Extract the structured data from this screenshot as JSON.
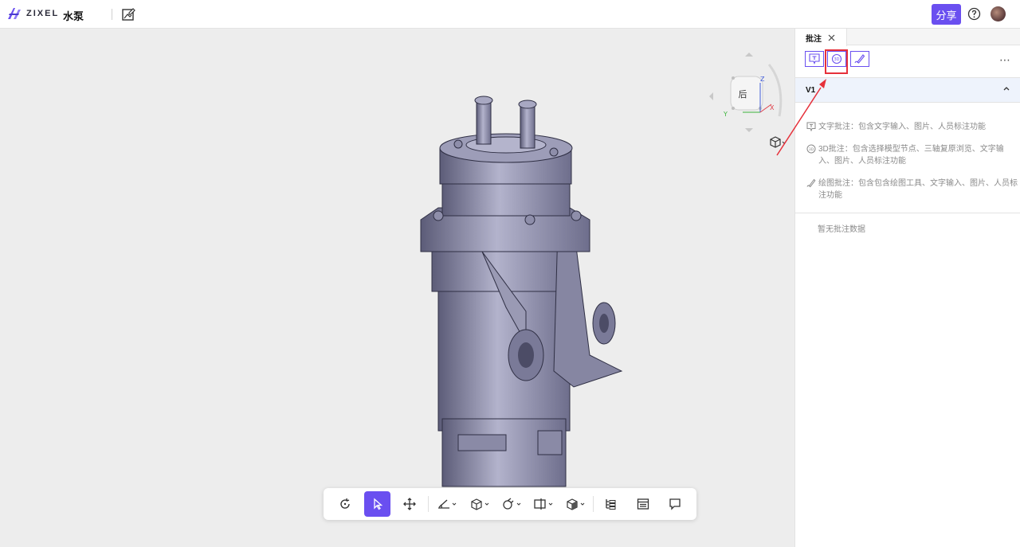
{
  "header": {
    "logo_text": "ZIXEL",
    "doc_title": "水泵",
    "share_label": "分享"
  },
  "viewport": {
    "nav_cube_face": "后",
    "axis_labels": [
      "Z",
      "Y",
      "X"
    ]
  },
  "toolbar": {
    "tools": [
      "rotate",
      "select",
      "pan",
      "measure",
      "section",
      "explode",
      "compare",
      "display-mode",
      "model-tree",
      "properties",
      "comments"
    ],
    "active_tool": "select"
  },
  "panel": {
    "tab_label": "批注",
    "annotation_tools": [
      "text-annotation",
      "3d-annotation",
      "draw-annotation"
    ],
    "version_label": "V1",
    "help_items": [
      {
        "icon": "text-annotation-icon",
        "text": "文字批注：包含文字输入、图片、人员标注功能"
      },
      {
        "icon": "3d-annotation-icon",
        "text": "3D批注：包含选择模型节点、三轴复原浏览、文字输入、图片、人员标注功能"
      },
      {
        "icon": "draw-annotation-icon",
        "text": "绘图批注：包含包含绘图工具、文字输入、图片、人员标注功能"
      }
    ],
    "empty_text": "暂无批注数据"
  },
  "colors": {
    "accent": "#6a4ff0",
    "highlight": "#e6303a",
    "version_row_bg": "#eef3fc"
  }
}
